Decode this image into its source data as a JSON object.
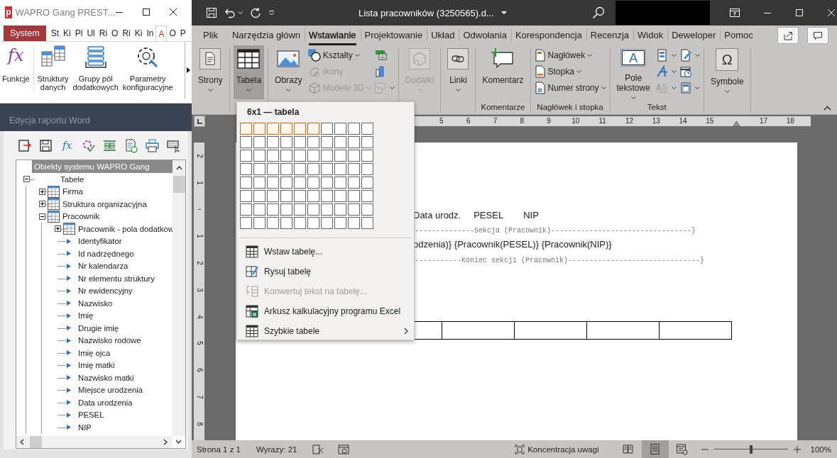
{
  "wapro_window": {
    "logo": "p",
    "title": "WAPRO Gang PREST...",
    "tabs": [
      {
        "label": "System",
        "kind": "app",
        "selected": false
      },
      {
        "label": "St",
        "kind": "tab",
        "selected": false
      },
      {
        "label": "Ki",
        "kind": "tab",
        "selected": false
      },
      {
        "label": "Pl",
        "kind": "tab",
        "selected": false
      },
      {
        "label": "Ul",
        "kind": "tab",
        "selected": false
      },
      {
        "label": "Ri",
        "kind": "tab",
        "selected": false
      },
      {
        "label": "O",
        "kind": "tab",
        "selected": false
      },
      {
        "label": "Ri",
        "kind": "tab",
        "selected": false
      },
      {
        "label": "Ki",
        "kind": "tab",
        "selected": false
      },
      {
        "label": "In",
        "kind": "tab",
        "selected": false
      },
      {
        "label": "A",
        "kind": "tab",
        "selected": true
      },
      {
        "label": "O",
        "kind": "tab",
        "selected": false
      },
      {
        "label": "P",
        "kind": "tab",
        "selected": false
      }
    ],
    "ribbon": [
      {
        "label": "Funkcje",
        "kind": "function",
        "glyph": "fx"
      },
      {
        "label": "Struktury\ndanych",
        "kind": "structures"
      },
      {
        "label": "Grupy pól\ndodatkowych",
        "kind": "groups"
      },
      {
        "label": "Parametry\nkonfiguracyjne",
        "kind": "settings"
      }
    ]
  },
  "report_editor": {
    "title": "Edycja raportu Word",
    "toolbar": [
      {
        "kind": "export"
      },
      {
        "kind": "save"
      },
      {
        "kind": "function",
        "glyph": "fx"
      },
      {
        "kind": "check"
      },
      {
        "kind": "layout"
      },
      {
        "kind": "document"
      },
      {
        "kind": "print"
      },
      {
        "kind": "keyboard"
      }
    ],
    "tree": {
      "header": "Obiekty systemu WAPRO Gang",
      "nodes": [
        {
          "label": "Tabele",
          "kind": "group",
          "expanded": true,
          "children": [
            {
              "label": "Firma",
              "kind": "table",
              "expanded": false
            },
            {
              "label": "Struktura organizacyjna",
              "kind": "table",
              "expanded": false
            },
            {
              "label": "Pracownik",
              "kind": "table",
              "expanded": true,
              "children": [
                {
                  "label": "Pracownik - pola dodatkow",
                  "kind": "table",
                  "expanded": false
                },
                {
                  "label": "Identyfikator",
                  "kind": "field"
                },
                {
                  "label": "Id nadrzędnego",
                  "kind": "field"
                },
                {
                  "label": "Nr kalendarza",
                  "kind": "field"
                },
                {
                  "label": "Nr elementu struktury",
                  "kind": "field"
                },
                {
                  "label": "Nr ewidencyjny",
                  "kind": "field"
                },
                {
                  "label": "Nazwisko",
                  "kind": "field"
                },
                {
                  "label": "Imię",
                  "kind": "field"
                },
                {
                  "label": "Drugie imię",
                  "kind": "field"
                },
                {
                  "label": "Nazwisko rodowe",
                  "kind": "field"
                },
                {
                  "label": "Imię ojca",
                  "kind": "field"
                },
                {
                  "label": "Imię matki",
                  "kind": "field"
                },
                {
                  "label": "Nazwisko matki",
                  "kind": "field"
                },
                {
                  "label": "Miejsce urodzenia",
                  "kind": "field"
                },
                {
                  "label": "Data urodzenia",
                  "kind": "field"
                },
                {
                  "label": "PESEL",
                  "kind": "field"
                },
                {
                  "label": "NIP",
                  "kind": "field"
                }
              ]
            }
          ]
        }
      ]
    }
  },
  "word": {
    "title": "Lista pracowników (3250565).d...",
    "tabs": [
      {
        "label": "Plik",
        "selected": false
      },
      {
        "label": "Narzędzia główn",
        "selected": false
      },
      {
        "label": "Wstawianie",
        "selected": true
      },
      {
        "label": "Projektowanie",
        "selected": false
      },
      {
        "label": "Układ",
        "selected": false
      },
      {
        "label": "Odwołania",
        "selected": false
      },
      {
        "label": "Korespondencja",
        "selected": false
      },
      {
        "label": "Recenzja",
        "selected": false
      },
      {
        "label": "Widok",
        "selected": false
      },
      {
        "label": "Deweloper",
        "selected": false
      },
      {
        "label": "Pomoc",
        "selected": false
      }
    ],
    "ribbon_groups": [
      {
        "buttons": [
          {
            "label": "Strony",
            "kind": "large",
            "menu": true,
            "selected": false,
            "disabled": false
          }
        ]
      },
      {
        "buttons": [
          {
            "label": "Tabela",
            "kind": "large",
            "menu": true,
            "selected": true,
            "disabled": false
          }
        ]
      },
      {
        "buttons": [
          {
            "label": "Obrazy",
            "kind": "large",
            "menu": true,
            "selected": false,
            "disabled": false
          },
          {
            "label": "Kształty",
            "kind": "small",
            "menu": true,
            "selected": false,
            "disabled": false
          },
          {
            "label": "Ikony",
            "kind": "small",
            "menu": false,
            "selected": false,
            "disabled": true
          },
          {
            "label": "Modele 3D",
            "kind": "small",
            "menu": true,
            "selected": false,
            "disabled": true
          }
        ]
      },
      {
        "buttons": [
          {
            "label": "Dodatki",
            "kind": "large",
            "menu": true,
            "selected": false,
            "disabled": true
          }
        ]
      },
      {
        "buttons": [
          {
            "label": "Linki",
            "kind": "large",
            "menu": true,
            "selected": false,
            "disabled": false
          }
        ]
      },
      {
        "label": "Komentarze",
        "buttons": [
          {
            "label": "Komentarz",
            "kind": "large",
            "menu": false,
            "selected": false,
            "disabled": false
          }
        ]
      },
      {
        "label": "Nagłówek i stopka",
        "buttons": [
          {
            "label": "Nagłówek",
            "kind": "small",
            "menu": true,
            "selected": false,
            "disabled": false
          },
          {
            "label": "Stopka",
            "kind": "small",
            "menu": true,
            "selected": false,
            "disabled": false
          },
          {
            "label": "Numer strony",
            "kind": "small",
            "menu": true,
            "selected": false,
            "disabled": false
          }
        ]
      },
      {
        "label": "Tekst",
        "buttons": [
          {
            "label": "Pole\ntekstowe",
            "kind": "large",
            "menu": true,
            "selected": false,
            "disabled": false,
            "glyph": "A"
          }
        ]
      },
      {
        "buttons": [
          {
            "label": "Symbole",
            "kind": "large",
            "menu": true,
            "selected": false,
            "disabled": false,
            "glyph": "Ω"
          }
        ]
      }
    ],
    "table_menu": {
      "header": "6x1 — tabela",
      "grid_rows": [
        {
          "cells": [
            {
              "selected": true
            },
            {
              "selected": true
            },
            {
              "selected": true
            },
            {
              "selected": true
            },
            {
              "selected": true
            },
            {
              "selected": true
            },
            {
              "selected": false
            },
            {
              "selected": false
            },
            {
              "selected": false
            },
            {
              "selected": false
            }
          ]
        },
        {
          "cells": [
            {
              "selected": false
            },
            {
              "selected": false
            },
            {
              "selected": false
            },
            {
              "selected": false
            },
            {
              "selected": false
            },
            {
              "selected": false
            },
            {
              "selected": false
            },
            {
              "selected": false
            },
            {
              "selected": false
            },
            {
              "selected": false
            }
          ]
        },
        {
          "cells": [
            {
              "selected": false
            },
            {
              "selected": false
            },
            {
              "selected": false
            },
            {
              "selected": false
            },
            {
              "selected": false
            },
            {
              "selected": false
            },
            {
              "selected": false
            },
            {
              "selected": false
            },
            {
              "selected": false
            },
            {
              "selected": false
            }
          ]
        },
        {
          "cells": [
            {
              "selected": false
            },
            {
              "selected": false
            },
            {
              "selected": false
            },
            {
              "selected": false
            },
            {
              "selected": false
            },
            {
              "selected": false
            },
            {
              "selected": false
            },
            {
              "selected": false
            },
            {
              "selected": false
            },
            {
              "selected": false
            }
          ]
        },
        {
          "cells": [
            {
              "selected": false
            },
            {
              "selected": false
            },
            {
              "selected": false
            },
            {
              "selected": false
            },
            {
              "selected": false
            },
            {
              "selected": false
            },
            {
              "selected": false
            },
            {
              "selected": false
            },
            {
              "selected": false
            },
            {
              "selected": false
            }
          ]
        },
        {
          "cells": [
            {
              "selected": false
            },
            {
              "selected": false
            },
            {
              "selected": false
            },
            {
              "selected": false
            },
            {
              "selected": false
            },
            {
              "selected": false
            },
            {
              "selected": false
            },
            {
              "selected": false
            },
            {
              "selected": false
            },
            {
              "selected": false
            }
          ]
        },
        {
          "cells": [
            {
              "selected": false
            },
            {
              "selected": false
            },
            {
              "selected": false
            },
            {
              "selected": false
            },
            {
              "selected": false
            },
            {
              "selected": false
            },
            {
              "selected": false
            },
            {
              "selected": false
            },
            {
              "selected": false
            },
            {
              "selected": false
            }
          ]
        },
        {
          "cells": [
            {
              "selected": false
            },
            {
              "selected": false
            },
            {
              "selected": false
            },
            {
              "selected": false
            },
            {
              "selected": false
            },
            {
              "selected": false
            },
            {
              "selected": false
            },
            {
              "selected": false
            },
            {
              "selected": false
            },
            {
              "selected": false
            }
          ]
        }
      ],
      "items": [
        {
          "label": "Wstaw tabelę...",
          "kind": "insert",
          "disabled": false,
          "submenu": false
        },
        {
          "label": "Rysuj tabelę",
          "kind": "draw",
          "disabled": false,
          "submenu": false
        },
        {
          "label": "Konwertuj tekst na tabelę...",
          "kind": "convert",
          "disabled": true,
          "submenu": false
        },
        {
          "label": "Arkusz kalkulacyjny programu Excel",
          "kind": "excel",
          "disabled": false,
          "submenu": false
        },
        {
          "label": "Szybkie tabele",
          "kind": "quick",
          "disabled": false,
          "submenu": true
        }
      ]
    },
    "ruler": {
      "horizontal": [
        {
          "kind": "number",
          "label": "5"
        },
        {
          "kind": "number",
          "label": "6"
        },
        {
          "kind": "number",
          "label": "7"
        },
        {
          "kind": "number",
          "label": "8"
        },
        {
          "kind": "number",
          "label": "9"
        },
        {
          "kind": "number",
          "label": "10"
        },
        {
          "kind": "number",
          "label": "11"
        },
        {
          "kind": "number",
          "label": "12"
        },
        {
          "kind": "number",
          "label": "13"
        },
        {
          "kind": "number",
          "label": "14"
        },
        {
          "kind": "number",
          "label": "15"
        },
        {
          "kind": "indent"
        },
        {
          "kind": "number",
          "label": "17"
        },
        {
          "kind": "number",
          "label": "18"
        }
      ],
      "vertical": [
        {
          "kind": "number",
          "label": "2"
        },
        {
          "kind": "number",
          "label": "1"
        },
        {
          "kind": "tick"
        },
        {
          "kind": "number",
          "label": "1"
        },
        {
          "kind": "number",
          "label": "2"
        },
        {
          "kind": "number",
          "label": "3"
        },
        {
          "kind": "number",
          "label": "4"
        },
        {
          "kind": "number",
          "label": "5"
        },
        {
          "kind": "number",
          "label": "6"
        },
        {
          "kind": "number",
          "label": "7"
        },
        {
          "kind": "number",
          "label": "8"
        }
      ]
    },
    "document": {
      "header_cells": [
        "Data urodz.",
        "PESEL",
        "NIP"
      ],
      "lines": [
        {
          "kind": "marker",
          "text": "--------------Sekcja (Pracownik)---------------------------------}"
        },
        {
          "kind": "fields",
          "text": "odzenia)} {Pracownik(PESEL)} {Pracownik(NIP)}"
        },
        {
          "kind": "marker",
          "text": "-----------Koniec sekcji (Pracownik)-------------------------------}"
        }
      ]
    },
    "status_bar": {
      "page": "Strona 1 z 1",
      "words": "Wyrazy: 21",
      "focus": "Koncentracja uwagi",
      "views": [
        {
          "selected": false
        },
        {
          "selected": true
        },
        {
          "selected": false
        }
      ],
      "zoom": {
        "level": 0.5,
        "reading": "100%"
      }
    }
  }
}
